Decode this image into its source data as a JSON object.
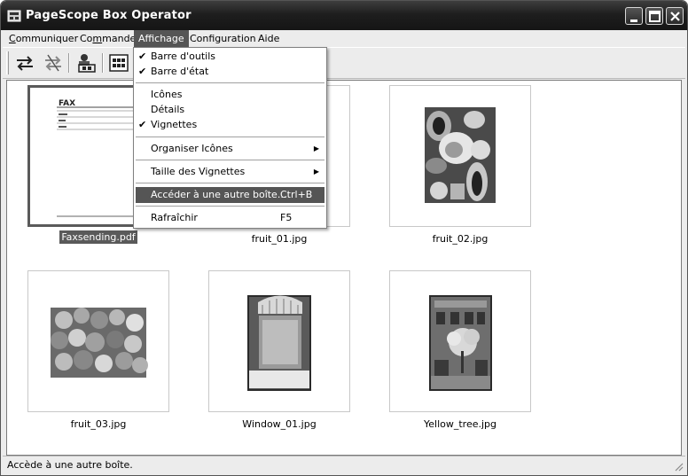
{
  "window": {
    "title": "PageScope Box Operator"
  },
  "menubar": {
    "items": [
      {
        "label_pre": "",
        "mnemonic": "C",
        "label_post": "ommuniquer"
      },
      {
        "label_pre": "Co",
        "mnemonic": "m",
        "label_post": "mande"
      },
      {
        "label_pre": "",
        "mnemonic": "",
        "label_post": "Affichage"
      },
      {
        "label_pre": "",
        "mnemonic": "",
        "label_post": "Configuration"
      },
      {
        "label_pre": "",
        "mnemonic": "",
        "label_post": "Aide"
      }
    ]
  },
  "view_menu": {
    "items": [
      {
        "label": "Barre d'outils",
        "checked": true
      },
      {
        "label": "Barre d'état",
        "checked": true
      },
      {
        "label": "Icônes",
        "checked": false
      },
      {
        "label": "Détails",
        "checked": false
      },
      {
        "label": "Vignettes",
        "checked": true
      },
      {
        "label": "Organiser Icônes",
        "submenu": true
      },
      {
        "label": "Taille des Vignettes",
        "submenu": true
      },
      {
        "label": "Accéder à une autre boîte...",
        "shortcut": "Ctrl+B",
        "highlighted": true
      },
      {
        "label": "Rafraîchir",
        "shortcut": "F5"
      }
    ],
    "check_glyph": "✔",
    "submenu_glyph": "▶"
  },
  "toolbar": {
    "icons": [
      "transfer-icon",
      "disconnect-icon",
      "box-settings-icon",
      "thumbnail-view-icon"
    ]
  },
  "files": [
    {
      "name": "Faxsending.pdf",
      "kind": "fax-document",
      "selected": true
    },
    {
      "name": "fruit_01.jpg",
      "kind": "photo"
    },
    {
      "name": "fruit_02.jpg",
      "kind": "photo"
    },
    {
      "name": "fruit_03.jpg",
      "kind": "photo"
    },
    {
      "name": "Window_01.jpg",
      "kind": "photo"
    },
    {
      "name": "Yellow_tree.jpg",
      "kind": "photo"
    }
  ],
  "fax_preview": {
    "heading": "FAX"
  },
  "statusbar": {
    "text": "Accède à une autre boîte."
  }
}
